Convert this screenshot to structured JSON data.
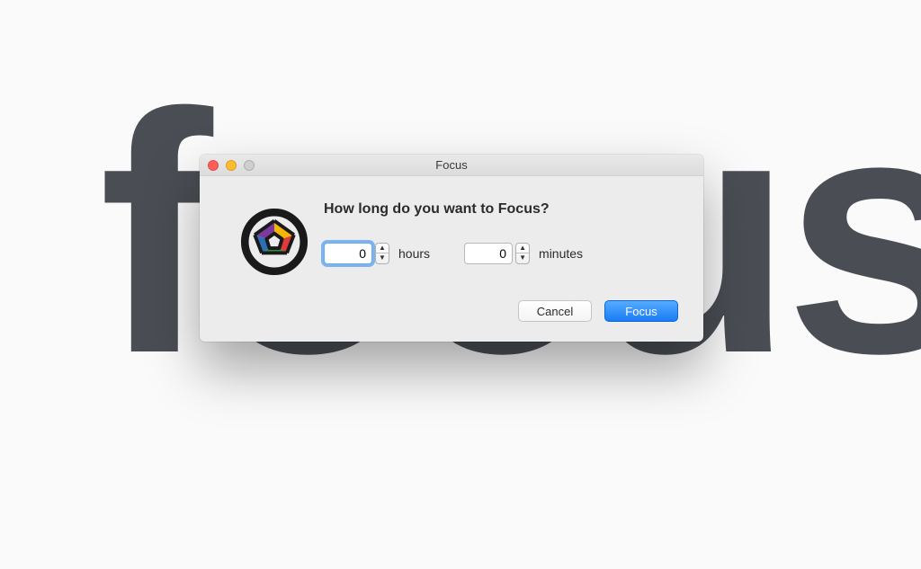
{
  "background_text": "focus",
  "window": {
    "title": "Focus"
  },
  "dialog": {
    "prompt": "How long do you want to Focus?",
    "hours": {
      "value": "0",
      "label": "hours"
    },
    "minutes": {
      "value": "0",
      "label": "minutes"
    },
    "buttons": {
      "cancel": "Cancel",
      "confirm": "Focus"
    }
  }
}
